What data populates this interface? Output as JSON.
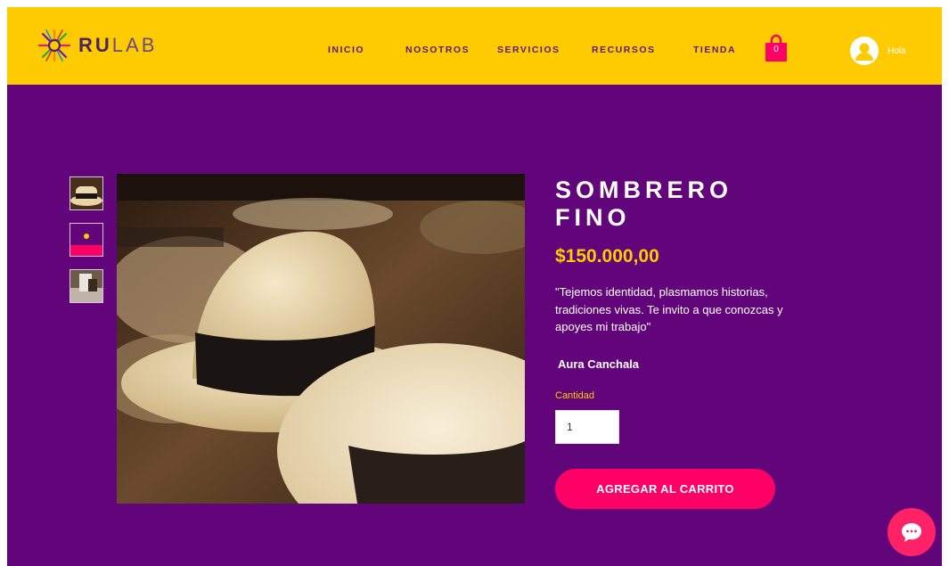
{
  "header": {
    "brand_bold": "RU",
    "brand_light": "LAB",
    "nav": [
      "INICIO",
      "NOSOTROS",
      "SERVICIOS",
      "RECURSOS",
      "TIENDA"
    ],
    "cart_count": "0",
    "user_label": "Hola"
  },
  "product": {
    "title": "SOMBRERO FINO",
    "price": "$150.000,00",
    "description": "\"Tejemos identidad, plasmamos historias, tradiciones vivas. Te invito a que conozcas y apoyes mi trabajo\"",
    "author": "Aura Canchala",
    "quantity_label": "Cantidad",
    "quantity_value": "1",
    "add_to_cart": "AGREGAR AL CARRITO"
  },
  "colors": {
    "header_bg": "#fdcb00",
    "page_bg": "#62057a",
    "accent": "#ff0066",
    "price": "#fdcb00"
  },
  "icons": {
    "logo": "sun-weave-logo-icon",
    "cart": "shopping-bag-icon",
    "user": "user-avatar-icon",
    "chat": "chat-bubble-icon"
  }
}
